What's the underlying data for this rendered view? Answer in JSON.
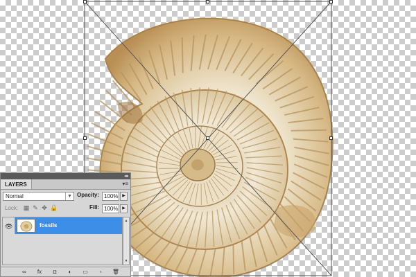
{
  "layers_panel": {
    "tab_label": "LAYERS",
    "collapse_glyph": "◂◂",
    "menu_glyph": "▾≡",
    "blend_mode": "Normal",
    "opacity_label": "Opacity:",
    "opacity_value": "100%",
    "lock_label": "Lock:",
    "fill_label": "Fill:",
    "fill_value": "100%",
    "layers": [
      {
        "name": "fossils",
        "visible": true,
        "selected": true
      }
    ],
    "footer_icons": [
      "link-layers-icon",
      "fx-icon",
      "add-mask-icon",
      "adjustment-layer-icon",
      "new-group-icon",
      "new-layer-icon",
      "delete-layer-icon"
    ],
    "footer_glyphs": [
      "∞",
      "fx",
      "◘",
      "◐",
      "▭",
      "▫",
      "🗑"
    ]
  },
  "colors": {
    "selection_blue": "#3d8ee7",
    "panel_bg": "#d6d6d6",
    "panel_topbar": "#5a5a5a"
  }
}
